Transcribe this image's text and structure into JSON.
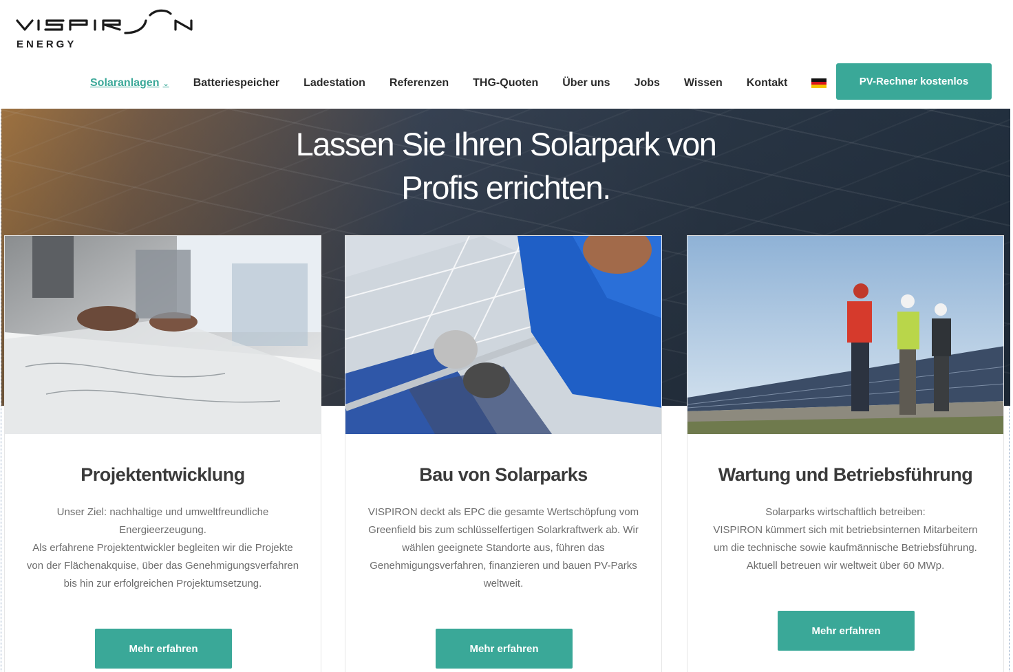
{
  "logo": {
    "wordmark": "VISPIRON",
    "sub": "ENERGY"
  },
  "nav": {
    "items": [
      {
        "label": "Solaranlagen",
        "active": true
      },
      {
        "label": "Batteriespeicher"
      },
      {
        "label": "Ladestation"
      },
      {
        "label": "Referenzen"
      },
      {
        "label": "THG-Quoten"
      },
      {
        "label": "Über uns"
      },
      {
        "label": "Jobs"
      },
      {
        "label": "Wissen"
      },
      {
        "label": "Kontakt"
      }
    ],
    "cta_label": "PV-Rechner kostenlos"
  },
  "hero": {
    "title_line1": "Lassen Sie Ihren Solarpark von",
    "title_line2": "Profis errichten."
  },
  "cards": [
    {
      "title": "Projektentwicklung",
      "text": [
        "Unser Ziel: nachhaltige und umweltfreundliche Energieerzeugung.",
        "Als erfahrene Projektentwickler begleiten wir die Projekte von der Flächenakquise, über das Genehmigungsverfahren bis hin zur erfolgreichen Projektumsetzung."
      ],
      "button": "Mehr erfahren"
    },
    {
      "title": "Bau von Solarparks",
      "text": [
        "VISPIRON deckt als EPC die gesamte Wertschöpfung vom Greenfield bis zum schlüsselfertigen Solarkraftwerk ab. Wir wählen geeignete Standorte aus, führen das Genehmigungsverfahren, finanzieren und bauen PV-Parks weltweit."
      ],
      "button": "Mehr erfahren"
    },
    {
      "title": "Wartung und Betriebsführung",
      "text": [
        "Solarparks wirtschaftlich betreiben:",
        "VISPIRON kümmert sich mit betriebsinternen Mitarbeitern um die technische sowie kaufmännische Betriebsführung. Aktuell betreuen wir weltweit über 60 MWp."
      ],
      "button": "Mehr erfahren"
    }
  ],
  "colors": {
    "accent": "#3aa898",
    "nav_text": "#2b2b2b",
    "body_text": "#6d6d6d"
  },
  "icons": {
    "nav_dropdown": "chevron-down-icon",
    "language": "german-flag-icon"
  }
}
